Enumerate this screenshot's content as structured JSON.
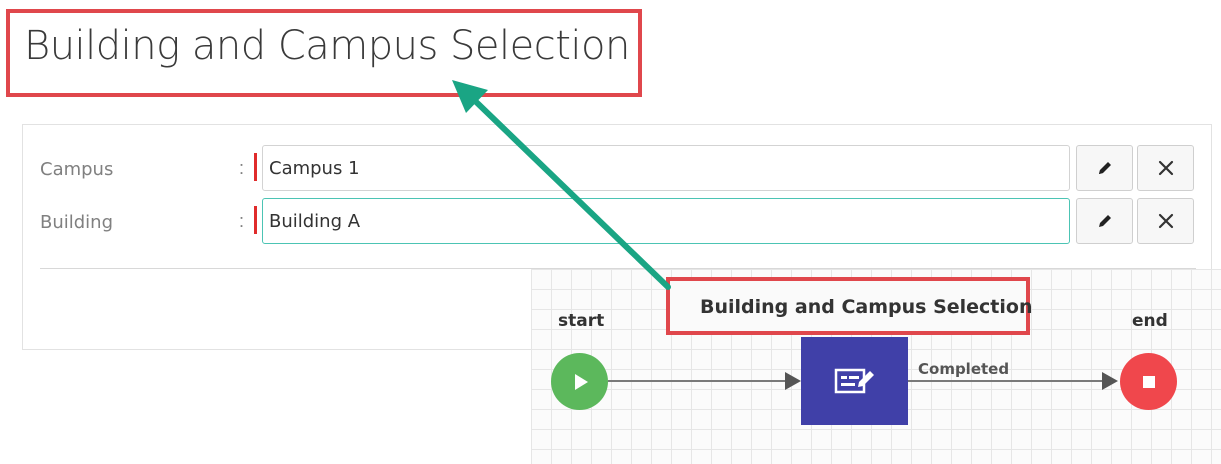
{
  "page_title": "Building and Campus Selection",
  "form": {
    "fields": [
      {
        "label": "Campus",
        "colon": ":",
        "value": "Campus 1",
        "edit_icon": "pencil-icon",
        "clear_icon": "close-icon"
      },
      {
        "label": "Building",
        "colon": ":",
        "value": "Building A",
        "edit_icon": "pencil-icon",
        "clear_icon": "close-icon"
      }
    ],
    "required_marker_color": "#e02b2b",
    "focus_color": "#4cc4b4"
  },
  "workflow": {
    "task_label": "Building and Campus Selection",
    "start_label": "start",
    "end_label": "end",
    "edge_label": "Completed",
    "start_color": "#5cb85c",
    "task_color": "#4040a8",
    "end_color": "#f0474c"
  },
  "annotation": {
    "highlight_color": "#e0474c",
    "arrow_color": "#1aa584"
  }
}
